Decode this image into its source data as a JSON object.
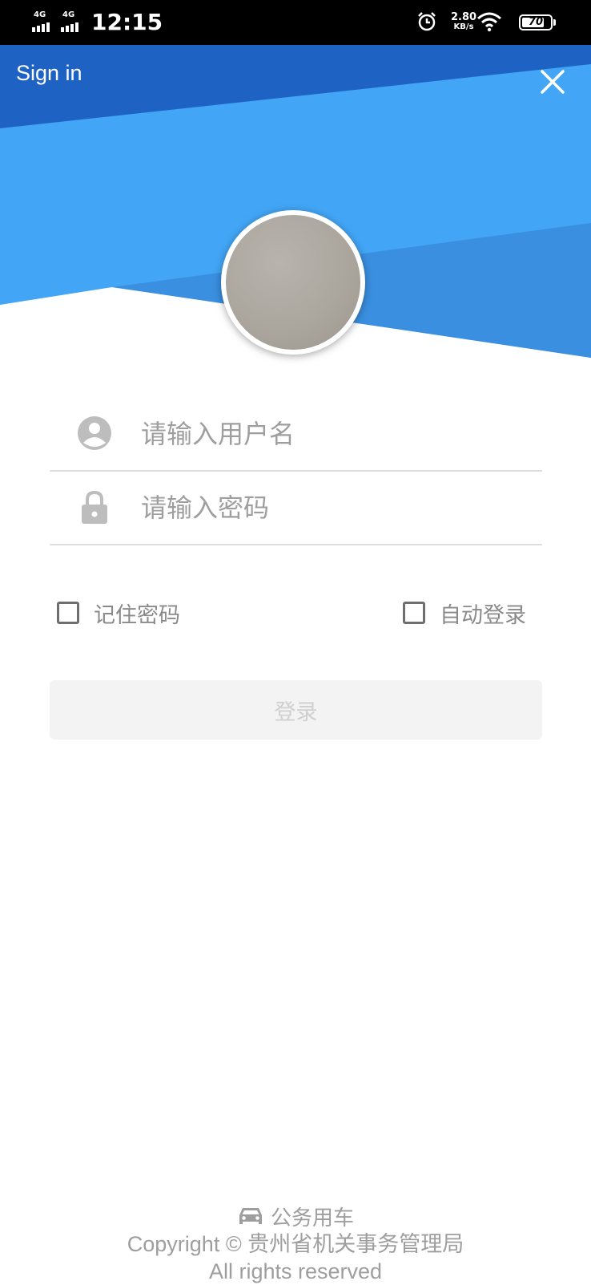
{
  "status_bar": {
    "signal_1_label": "4G",
    "signal_2_label": "4G",
    "time": "12:15",
    "net_speed_value": "2.80",
    "net_speed_unit": "KB/s",
    "battery_level": "70",
    "icons": [
      "alarm-icon",
      "wifi-icon",
      "battery-icon"
    ]
  },
  "header": {
    "title": "Sign in",
    "close_icon": "close-icon",
    "colors": {
      "light_blue": "#42a5f5",
      "dark_blue": "#1e63c4",
      "mid_blue": "#3a8fe0"
    }
  },
  "form": {
    "username_placeholder": "请输入用户名",
    "password_placeholder": "请输入密码",
    "remember_label": "记住密码",
    "auto_login_label": "自动登录",
    "login_button": "登录"
  },
  "footer": {
    "app_name": "公务用车",
    "copyright": "Copyright © 贵州省机关事务管理局",
    "rights": "All rights reserved"
  }
}
